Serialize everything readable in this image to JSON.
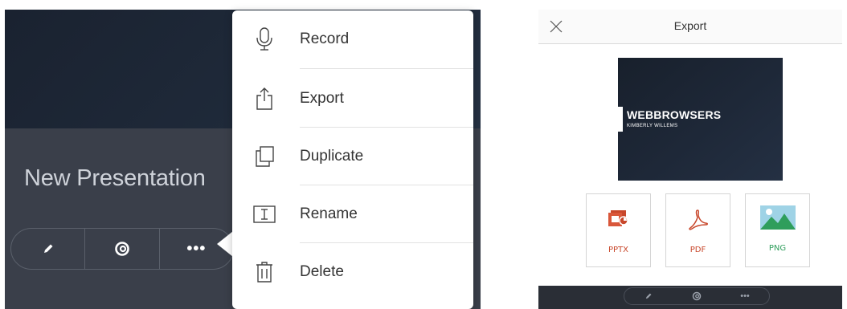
{
  "left": {
    "presentation_title": "New Presentation",
    "actions": [
      {
        "name": "edit",
        "icon": "pencil-icon"
      },
      {
        "name": "play",
        "icon": "swirl-icon"
      },
      {
        "name": "more",
        "label": "•••",
        "icon": "more-icon"
      }
    ],
    "menu": [
      {
        "label": "Record",
        "icon": "microphone-icon"
      },
      {
        "label": "Export",
        "icon": "share-icon"
      },
      {
        "label": "Duplicate",
        "icon": "duplicate-icon"
      },
      {
        "label": "Rename",
        "icon": "rename-icon"
      },
      {
        "label": "Delete",
        "icon": "trash-icon"
      }
    ]
  },
  "right": {
    "dialog_title": "Export",
    "slide": {
      "title": "WEBBROWSERS",
      "subtitle": "KIMBERLY WILLEMS"
    },
    "formats": [
      {
        "label": "PPTX",
        "icon": "pptx-icon",
        "color": "#c8472b"
      },
      {
        "label": "PDF",
        "icon": "pdf-icon",
        "color": "#c8472b"
      },
      {
        "label": "PNG",
        "icon": "png-image-icon",
        "color": "#2f9e5c"
      }
    ],
    "dock": {
      "more_label": "•••"
    }
  },
  "colors": {
    "panel_bg": "#3a3f4a",
    "accent_red": "#c8472b",
    "accent_green": "#2f9e5c"
  }
}
